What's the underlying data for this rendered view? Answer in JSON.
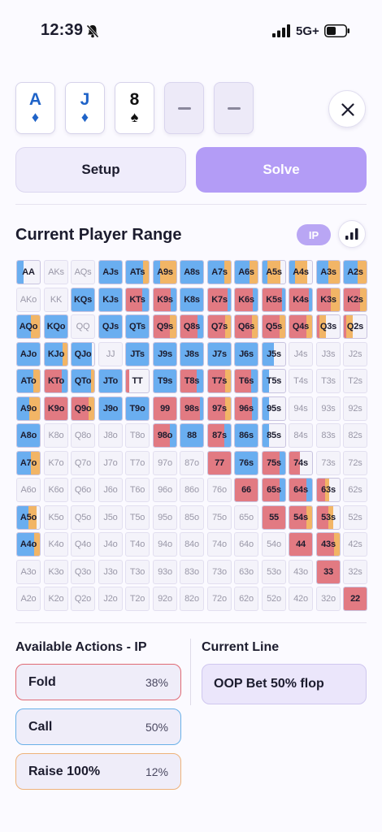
{
  "status": {
    "time": "12:39",
    "network": "5G+"
  },
  "board": {
    "cards": [
      {
        "rank": "A",
        "suit": "♦",
        "color": "red"
      },
      {
        "rank": "J",
        "suit": "♦",
        "color": "red"
      },
      {
        "rank": "8",
        "suit": "♠",
        "color": "black"
      }
    ],
    "empty_slots": 2
  },
  "buttons": {
    "setup": "Setup",
    "solve": "Solve"
  },
  "range": {
    "title": "Current Player Range",
    "player_badge": "IP",
    "colors": {
      "fold": "#e27a82",
      "call": "#6aaef0",
      "raise": "#f2b566",
      "inactive": "#f4f3fa"
    },
    "hands": [
      [
        "AA",
        "AKs",
        "AQs",
        "AJs",
        "ATs",
        "A9s",
        "A8s",
        "A7s",
        "A6s",
        "A5s",
        "A4s",
        "A3s",
        "A2s"
      ],
      [
        "AKo",
        "KK",
        "KQs",
        "KJs",
        "KTs",
        "K9s",
        "K8s",
        "K7s",
        "K6s",
        "K5s",
        "K4s",
        "K3s",
        "K2s"
      ],
      [
        "AQo",
        "KQo",
        "QQ",
        "QJs",
        "QTs",
        "Q9s",
        "Q8s",
        "Q7s",
        "Q6s",
        "Q5s",
        "Q4s",
        "Q3s",
        "Q2s"
      ],
      [
        "AJo",
        "KJo",
        "QJo",
        "JJ",
        "JTs",
        "J9s",
        "J8s",
        "J7s",
        "J6s",
        "J5s",
        "J4s",
        "J3s",
        "J2s"
      ],
      [
        "ATo",
        "KTo",
        "QTo",
        "JTo",
        "TT",
        "T9s",
        "T8s",
        "T7s",
        "T6s",
        "T5s",
        "T4s",
        "T3s",
        "T2s"
      ],
      [
        "A9o",
        "K9o",
        "Q9o",
        "J9o",
        "T9o",
        "99",
        "98s",
        "97s",
        "96s",
        "95s",
        "94s",
        "93s",
        "92s"
      ],
      [
        "A8o",
        "K8o",
        "Q8o",
        "J8o",
        "T8o",
        "98o",
        "88",
        "87s",
        "86s",
        "85s",
        "84s",
        "83s",
        "82s"
      ],
      [
        "A7o",
        "K7o",
        "Q7o",
        "J7o",
        "T7o",
        "97o",
        "87o",
        "77",
        "76s",
        "75s",
        "74s",
        "73s",
        "72s"
      ],
      [
        "A6o",
        "K6o",
        "Q6o",
        "J6o",
        "T6o",
        "96o",
        "86o",
        "76o",
        "66",
        "65s",
        "64s",
        "63s",
        "62s"
      ],
      [
        "A5o",
        "K5o",
        "Q5o",
        "J5o",
        "T5o",
        "95o",
        "85o",
        "75o",
        "65o",
        "55",
        "54s",
        "53s",
        "52s"
      ],
      [
        "A4o",
        "K4o",
        "Q4o",
        "J4o",
        "T4o",
        "94o",
        "84o",
        "74o",
        "64o",
        "54o",
        "44",
        "43s",
        "42s"
      ],
      [
        "A3o",
        "K3o",
        "Q3o",
        "J3o",
        "T3o",
        "93o",
        "83o",
        "73o",
        "63o",
        "53o",
        "43o",
        "33",
        "32s"
      ],
      [
        "A2o",
        "K2o",
        "Q2o",
        "J2o",
        "T2o",
        "92o",
        "82o",
        "72o",
        "62o",
        "52o",
        "42o",
        "32o",
        "22"
      ]
    ],
    "strategy": {
      "AA": [
        0,
        0.3,
        0
      ],
      "AJs": [
        0,
        1,
        0
      ],
      "ATs": [
        0,
        0.75,
        0.25
      ],
      "A9s": [
        0,
        0.3,
        0.7
      ],
      "A8s": [
        0,
        1,
        0
      ],
      "A7s": [
        0,
        0.7,
        0.3
      ],
      "A6s": [
        0,
        0.65,
        0.35
      ],
      "A5s": [
        0,
        0.2,
        0.6
      ],
      "A4s": [
        0,
        0.25,
        0.55
      ],
      "A3s": [
        0,
        0.5,
        0.5
      ],
      "A2s": [
        0,
        0.6,
        0.4
      ],
      "KQs": [
        0,
        1,
        0
      ],
      "KJs": [
        0,
        1,
        0
      ],
      "KTs": [
        0.7,
        0.3,
        0
      ],
      "K9s": [
        0.75,
        0.25,
        0
      ],
      "K8s": [
        0,
        1,
        0
      ],
      "K7s": [
        0.85,
        0.15,
        0
      ],
      "K6s": [
        0.8,
        0.2,
        0
      ],
      "K5s": [
        0.85,
        0.15,
        0
      ],
      "K4s": [
        0.85,
        0.15,
        0
      ],
      "K3s": [
        0.6,
        0,
        0.4
      ],
      "K2s": [
        0.7,
        0,
        0.3
      ],
      "AQo": [
        0,
        0.6,
        0.4
      ],
      "KQo": [
        0,
        1,
        0
      ],
      "QJs": [
        0,
        1,
        0
      ],
      "QTs": [
        0,
        1,
        0
      ],
      "Q9s": [
        0.7,
        0,
        0.3
      ],
      "Q8s": [
        0.75,
        0.25,
        0
      ],
      "Q7s": [
        0.75,
        0,
        0.25
      ],
      "Q6s": [
        0.75,
        0,
        0.25
      ],
      "Q5s": [
        0.75,
        0,
        0.25
      ],
      "Q4s": [
        0.75,
        0,
        0.25
      ],
      "Q3s": [
        0.1,
        0,
        0.3
      ],
      "Q2s": [
        0.1,
        0,
        0.3
      ],
      "AJo": [
        0,
        1,
        0
      ],
      "KJo": [
        0,
        0.8,
        0.2
      ],
      "QJo": [
        0,
        0.9,
        0
      ],
      "JTs": [
        0,
        1,
        0
      ],
      "J9s": [
        0,
        1,
        0
      ],
      "J8s": [
        0,
        1,
        0
      ],
      "J7s": [
        0,
        1,
        0
      ],
      "J6s": [
        0,
        1,
        0
      ],
      "J5s": [
        0,
        0.5,
        0
      ],
      "ATo": [
        0,
        0.7,
        0.3
      ],
      "KTo": [
        0.75,
        0.25,
        0
      ],
      "QTo": [
        0,
        0.85,
        0.15
      ],
      "JTo": [
        0,
        1,
        0
      ],
      "TT": [
        0.15,
        0,
        0
      ],
      "T9s": [
        0,
        1,
        0
      ],
      "T8s": [
        0.7,
        0.3,
        0
      ],
      "T7s": [
        0.75,
        0,
        0.25
      ],
      "T6s": [
        0.7,
        0.3,
        0
      ],
      "T5s": [
        0,
        0.3,
        0
      ],
      "A9o": [
        0,
        0.55,
        0.45
      ],
      "K9o": [
        1,
        0,
        0
      ],
      "Q9o": [
        0.75,
        0,
        0.25
      ],
      "J9o": [
        0,
        1,
        0
      ],
      "T9o": [
        0,
        1,
        0
      ],
      "99": [
        1,
        0,
        0
      ],
      "98s": [
        0.85,
        0.15,
        0
      ],
      "97s": [
        0.75,
        0,
        0.25
      ],
      "96s": [
        0.75,
        0.25,
        0
      ],
      "95s": [
        0,
        0.3,
        0
      ],
      "A8o": [
        0,
        1,
        0
      ],
      "98o": [
        0.7,
        0.3,
        0
      ],
      "88": [
        0,
        1,
        0
      ],
      "87s": [
        0.7,
        0.3,
        0
      ],
      "86s": [
        0,
        1,
        0
      ],
      "85s": [
        0,
        0.3,
        0
      ],
      "A7o": [
        0,
        0.6,
        0.4
      ],
      "77": [
        1,
        0,
        0
      ],
      "76s": [
        0,
        1,
        0
      ],
      "75s": [
        0.75,
        0.25,
        0
      ],
      "74s": [
        0.45,
        0,
        0
      ],
      "66": [
        1,
        0,
        0
      ],
      "65s": [
        0.75,
        0.25,
        0
      ],
      "64s": [
        0.75,
        0.25,
        0
      ],
      "63s": [
        0.35,
        0,
        0.2
      ],
      "A5o": [
        0,
        0.5,
        0.35
      ],
      "55": [
        1,
        0,
        0
      ],
      "54s": [
        0.75,
        0,
        0.25
      ],
      "53s": [
        0.5,
        0,
        0.2
      ],
      "A4o": [
        0,
        0.75,
        0.25
      ],
      "44": [
        1,
        0,
        0
      ],
      "43s": [
        0.75,
        0,
        0.25
      ],
      "33": [
        1,
        0,
        0
      ],
      "22": [
        1,
        0,
        0
      ]
    }
  },
  "actions": {
    "title": "Available Actions - IP",
    "items": [
      {
        "name": "Fold",
        "pct": "38%"
      },
      {
        "name": "Call",
        "pct": "50%"
      },
      {
        "name": "Raise 100%",
        "pct": "12%"
      }
    ]
  },
  "current_line": {
    "title": "Current Line",
    "value": "OOP Bet 50% flop"
  }
}
